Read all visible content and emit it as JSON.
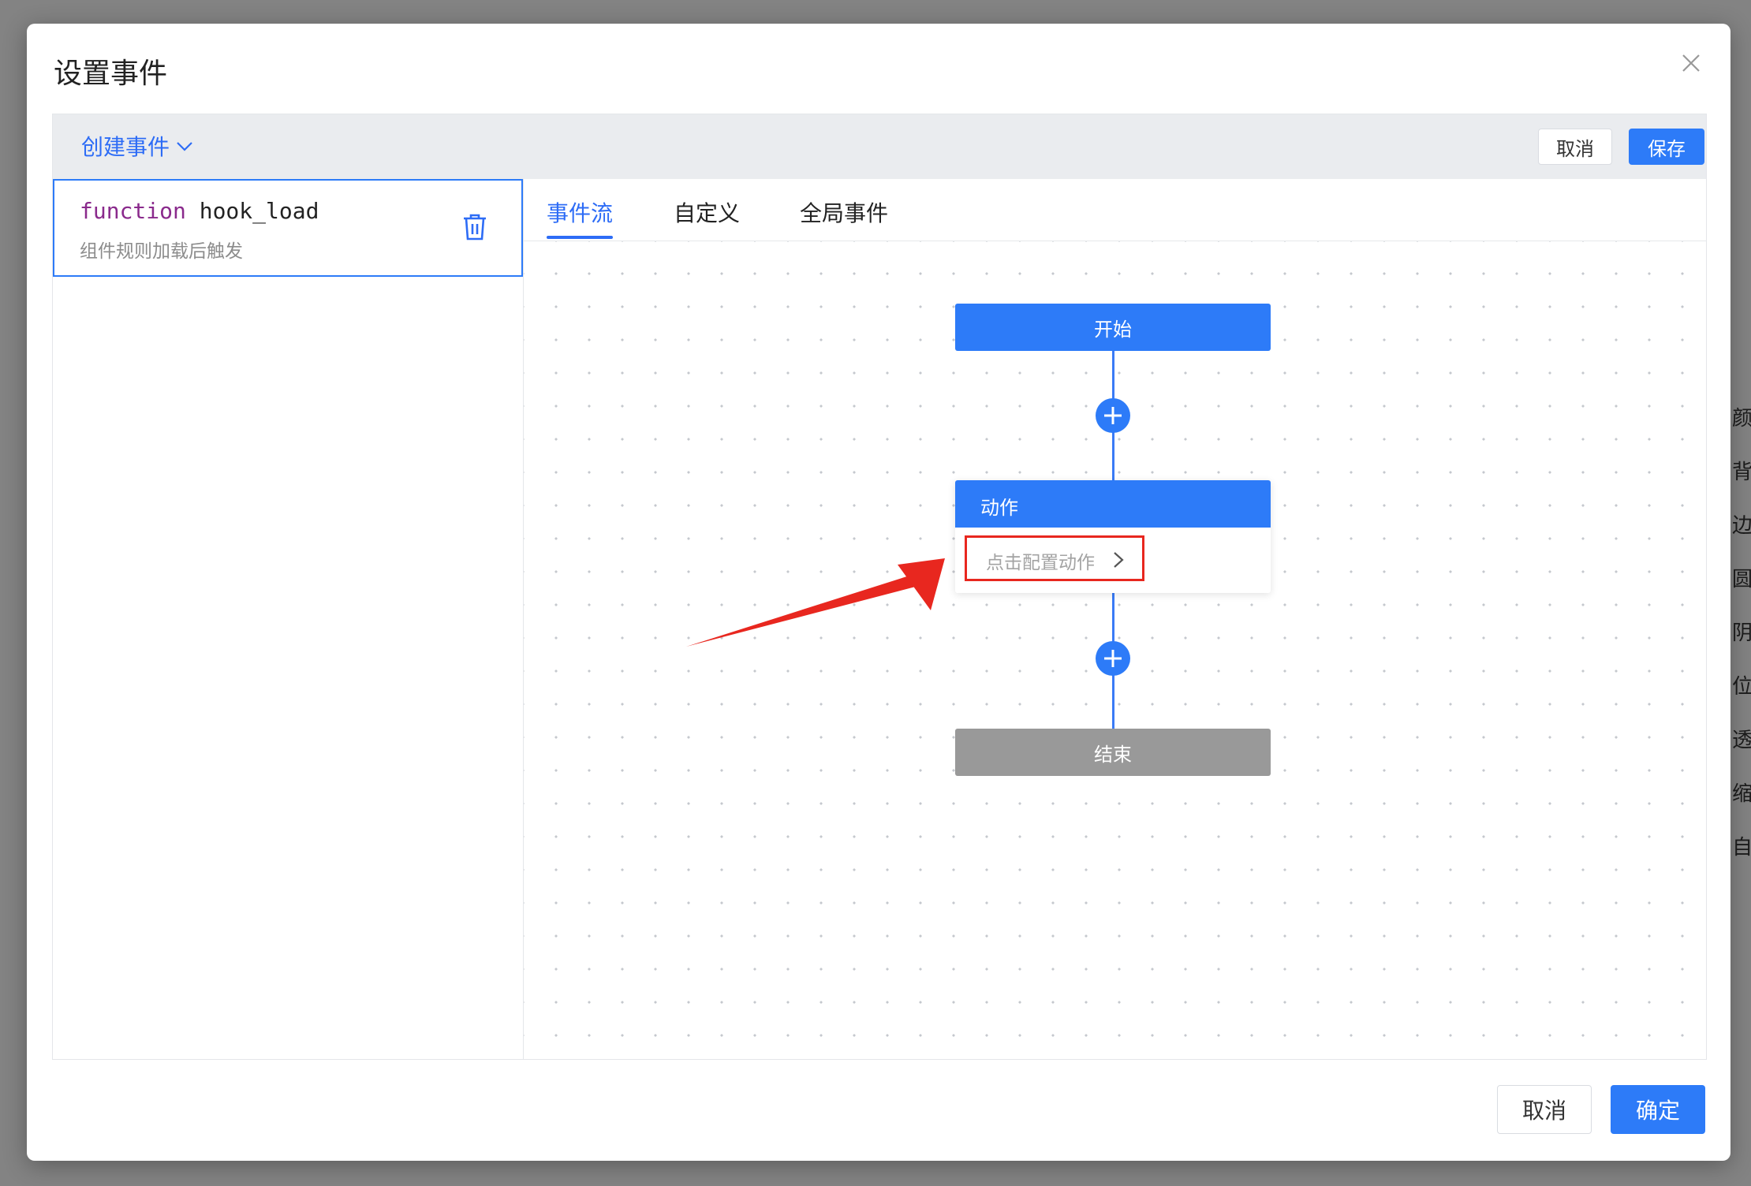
{
  "dialog": {
    "title": "设置事件"
  },
  "toolbar": {
    "create_event_label": "创建事件",
    "cancel_label": "取消",
    "save_label": "保存"
  },
  "event_list": {
    "items": [
      {
        "keyword": "function",
        "name": "hook_load",
        "description": "组件规则加载后触发"
      }
    ]
  },
  "tabs": [
    {
      "label": "事件流"
    },
    {
      "label": "自定义"
    },
    {
      "label": "全局事件"
    }
  ],
  "flow": {
    "start_label": "开始",
    "action_title": "动作",
    "action_placeholder": "点击配置动作",
    "end_label": "结束"
  },
  "footer": {
    "cancel_label": "取消",
    "confirm_label": "确定"
  },
  "background": {
    "side_labels": [
      "颜",
      "背",
      "边",
      "圆",
      "阴",
      "位",
      "透",
      "缩",
      "自"
    ]
  },
  "colors": {
    "primary": "#2d7bf8",
    "annotation": "#e8271f",
    "end_node": "#999999"
  }
}
